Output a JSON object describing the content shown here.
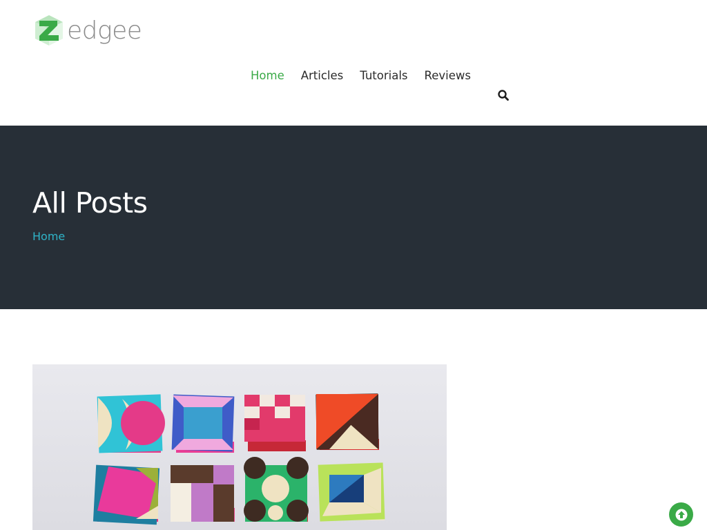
{
  "brand": {
    "name": "edgee",
    "accent": "#3aaa47"
  },
  "nav": {
    "items": [
      {
        "label": "Home",
        "active": true
      },
      {
        "label": "Articles",
        "active": false
      },
      {
        "label": "Tutorials",
        "active": false
      },
      {
        "label": "Reviews",
        "active": false
      }
    ],
    "search_icon": "search-icon"
  },
  "hero": {
    "title": "All Posts",
    "breadcrumb": "Home",
    "background": "#272f37",
    "breadcrumb_color": "#2fb4c8"
  },
  "posts": [
    {
      "image_icon": "thank-you-cards-photo"
    }
  ],
  "back_to_top": {
    "icon": "arrow-up-icon",
    "color": "#3aaa47"
  }
}
